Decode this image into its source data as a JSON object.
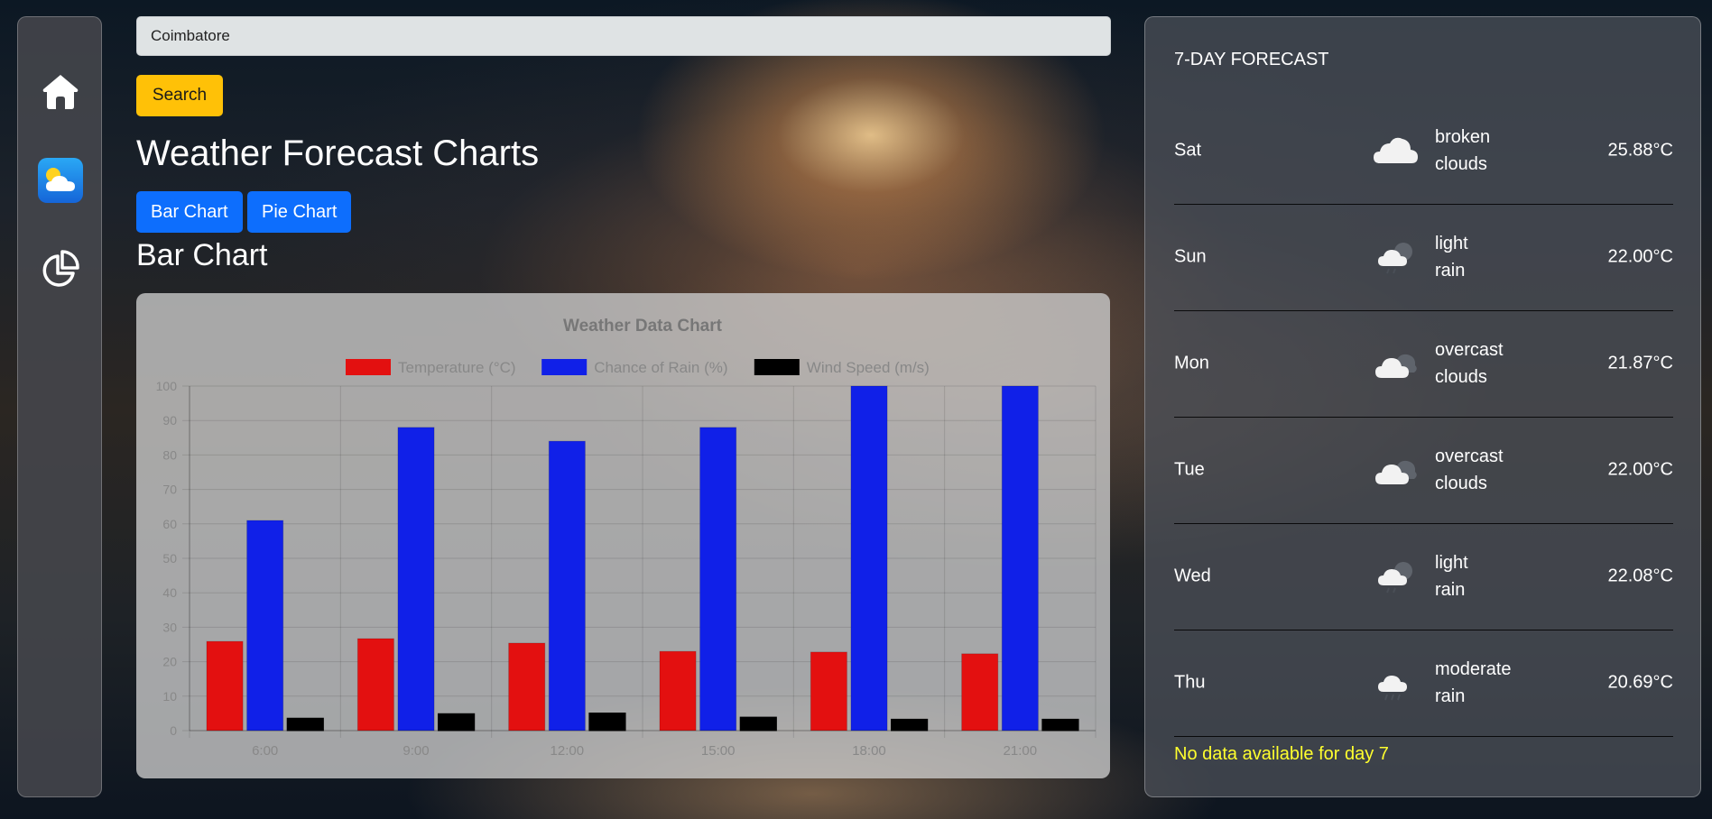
{
  "search": {
    "value": "Coimbatore",
    "button_label": "Search"
  },
  "page_title": "Weather Forecast Charts",
  "chart_buttons": [
    {
      "label": "Bar Chart"
    },
    {
      "label": "Pie Chart"
    }
  ],
  "section_title": "Bar Chart",
  "chart_data": {
    "type": "bar",
    "title": "Weather Data Chart",
    "categories": [
      "6:00",
      "9:00",
      "12:00",
      "15:00",
      "18:00",
      "21:00"
    ],
    "series": [
      {
        "name": "Temperature (°C)",
        "color": "#e31010",
        "values": [
          25.9,
          26.7,
          25.4,
          23.0,
          22.8,
          22.3
        ]
      },
      {
        "name": "Chance of Rain (%)",
        "color": "#1020e8",
        "values": [
          61,
          88,
          84,
          88,
          100,
          100
        ]
      },
      {
        "name": "Wind Speed (m/s)",
        "color": "#000000",
        "values": [
          3.6,
          4.9,
          5.1,
          3.9,
          3.3,
          3.3
        ]
      }
    ],
    "ylim": [
      0,
      100
    ],
    "yticks": [
      0,
      10,
      20,
      30,
      40,
      50,
      60,
      70,
      80,
      90,
      100
    ],
    "grid": true,
    "legend": "top"
  },
  "forecast": {
    "title": "7-DAY FORECAST",
    "days": [
      {
        "day": "Sat",
        "desc_line1": "broken",
        "desc_line2": "clouds",
        "temp": "25.88°C",
        "icon": "broken-clouds-icon"
      },
      {
        "day": "Sun",
        "desc_line1": "light",
        "desc_line2": "rain",
        "temp": "22.00°C",
        "icon": "light-rain-icon"
      },
      {
        "day": "Mon",
        "desc_line1": "overcast",
        "desc_line2": "clouds",
        "temp": "21.87°C",
        "icon": "overcast-clouds-icon"
      },
      {
        "day": "Tue",
        "desc_line1": "overcast",
        "desc_line2": "clouds",
        "temp": "22.00°C",
        "icon": "overcast-clouds-icon"
      },
      {
        "day": "Wed",
        "desc_line1": "light",
        "desc_line2": "rain",
        "temp": "22.08°C",
        "icon": "light-rain-icon"
      },
      {
        "day": "Thu",
        "desc_line1": "moderate",
        "desc_line2": "rain",
        "temp": "20.69°C",
        "icon": "moderate-rain-icon"
      }
    ],
    "note": "No data available for day 7"
  },
  "colors": {
    "accent_blue": "#0d6efd",
    "search_button": "#ffc107",
    "note_yellow": "#ffff2e"
  }
}
